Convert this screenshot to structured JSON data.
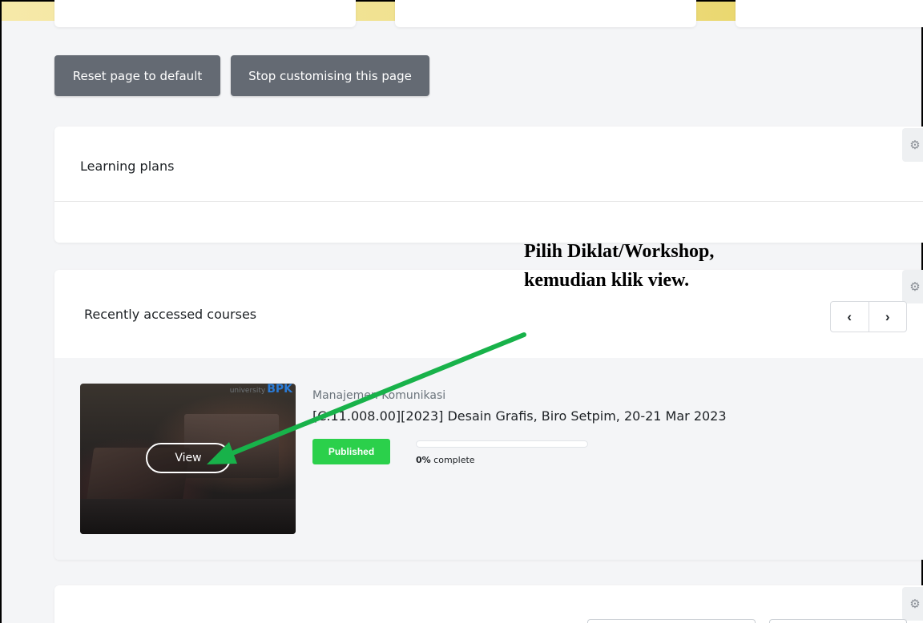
{
  "toolbar": {
    "reset_label": "Reset page to default",
    "stop_label": "Stop customising this page"
  },
  "learning_plans": {
    "title": "Learning plans",
    "gear_icon": "gear-icon"
  },
  "recent_courses": {
    "title": "Recently accessed courses",
    "prev_icon": "‹",
    "next_icon": "›",
    "gear_icon": "gear-icon",
    "course": {
      "image_logo_small": "university",
      "image_logo_big": "BPK",
      "view_label": "View",
      "category": "Manajemen Komunikasi",
      "name": "[C.11.008.00][2023] Desain Grafis, Biro Setpim, 20-21 Mar 2023",
      "status_badge": "Published",
      "progress_percent": 0,
      "progress_value": "0%",
      "progress_suffix": " complete"
    }
  },
  "annotation": {
    "line1": "Pilih Diklat/Workshop,",
    "line2": "kemudian klik view."
  },
  "colors": {
    "accent_green": "#2bd04b",
    "arrow_green": "#18b24a",
    "button_gray": "#646a73",
    "top_strip": "#efe08a"
  }
}
